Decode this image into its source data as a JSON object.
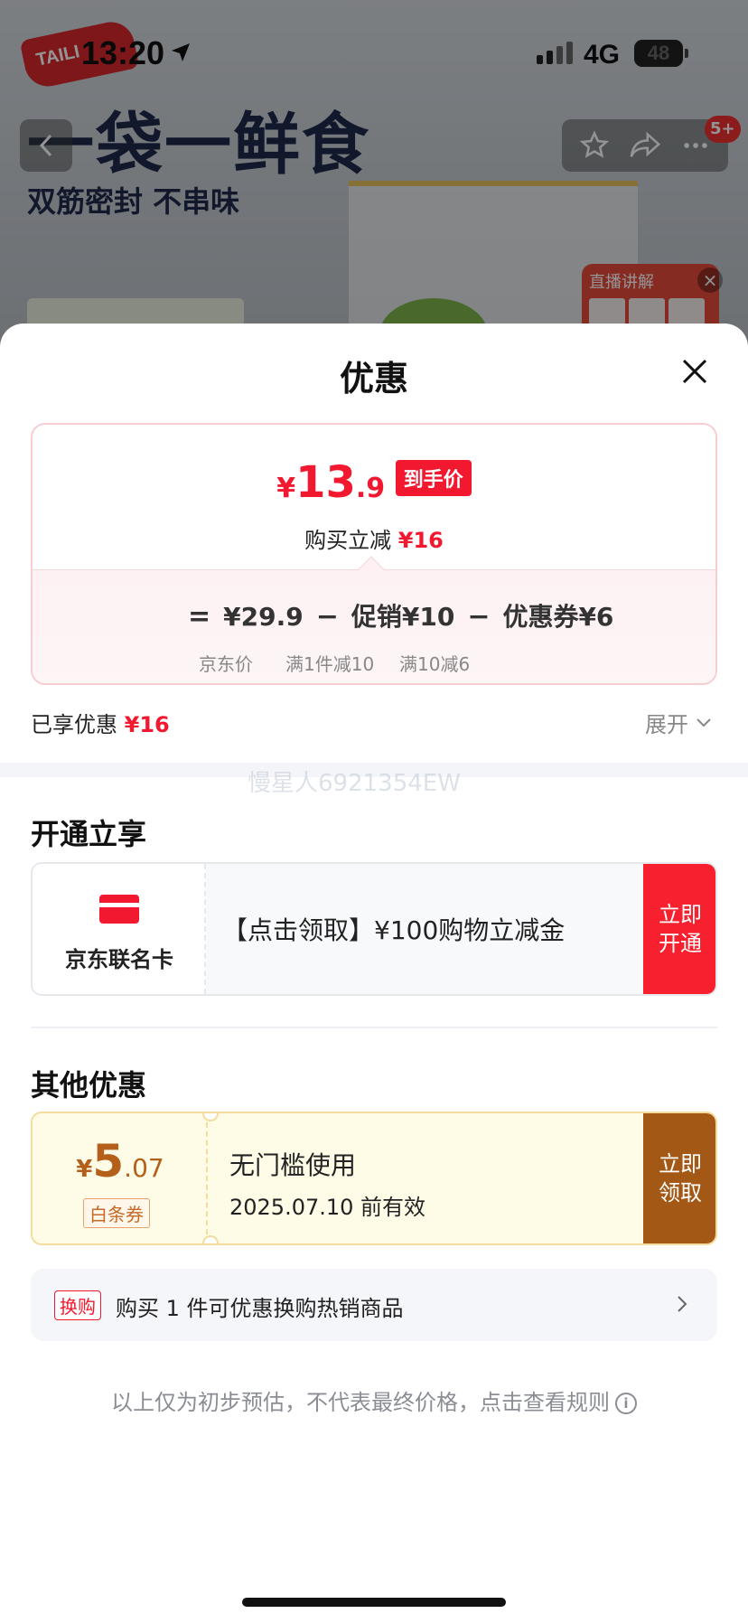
{
  "status_bar": {
    "time": "13:20",
    "network": "4G",
    "battery": "48"
  },
  "background": {
    "brand": "TAILI",
    "headline": "一袋一鲜食",
    "subheadline": "双筋密封 不串味",
    "message_badge": "5+",
    "live_card": "直播讲解"
  },
  "sheet": {
    "title": "优惠",
    "price_summary": {
      "currency": "¥",
      "final_int": "13",
      "final_dec": ".9",
      "final_tag": "到手价",
      "reduce_label": "购买立减",
      "reduce_value": "¥16",
      "equals": "=",
      "minus": "−",
      "jd_price": "¥29.9",
      "jd_price_label": "京东价",
      "promo": "促销¥10",
      "promo_label": "满1件减10",
      "coupon": "优惠券¥6",
      "coupon_label": "满10减6"
    },
    "enjoyed_label": "已享优惠",
    "enjoyed_value": "¥16",
    "expand_label": "展开",
    "watermark": "慢星人6921354EW",
    "open_section": {
      "title": "开通立享",
      "card_name": "京东联名卡",
      "desc": "【点击领取】¥100购物立减金",
      "button_line1": "立即",
      "button_line2": "开通"
    },
    "other_section": {
      "title": "其他优惠",
      "coupon": {
        "currency": "¥",
        "int": "5",
        "dec": ".07",
        "tag": "白条券",
        "title": "无门槛使用",
        "date": "2025.07.10 前有效",
        "button_line1": "立即",
        "button_line2": "领取"
      },
      "swap": {
        "tag": "换购",
        "text": "购买 1 件可优惠换购热销商品"
      }
    },
    "rule_note": "以上仅为初步预估，不代表最终价格，点击查看规则"
  },
  "colors": {
    "accent_red": "#f2182f",
    "coupon_brown": "#a35816"
  }
}
